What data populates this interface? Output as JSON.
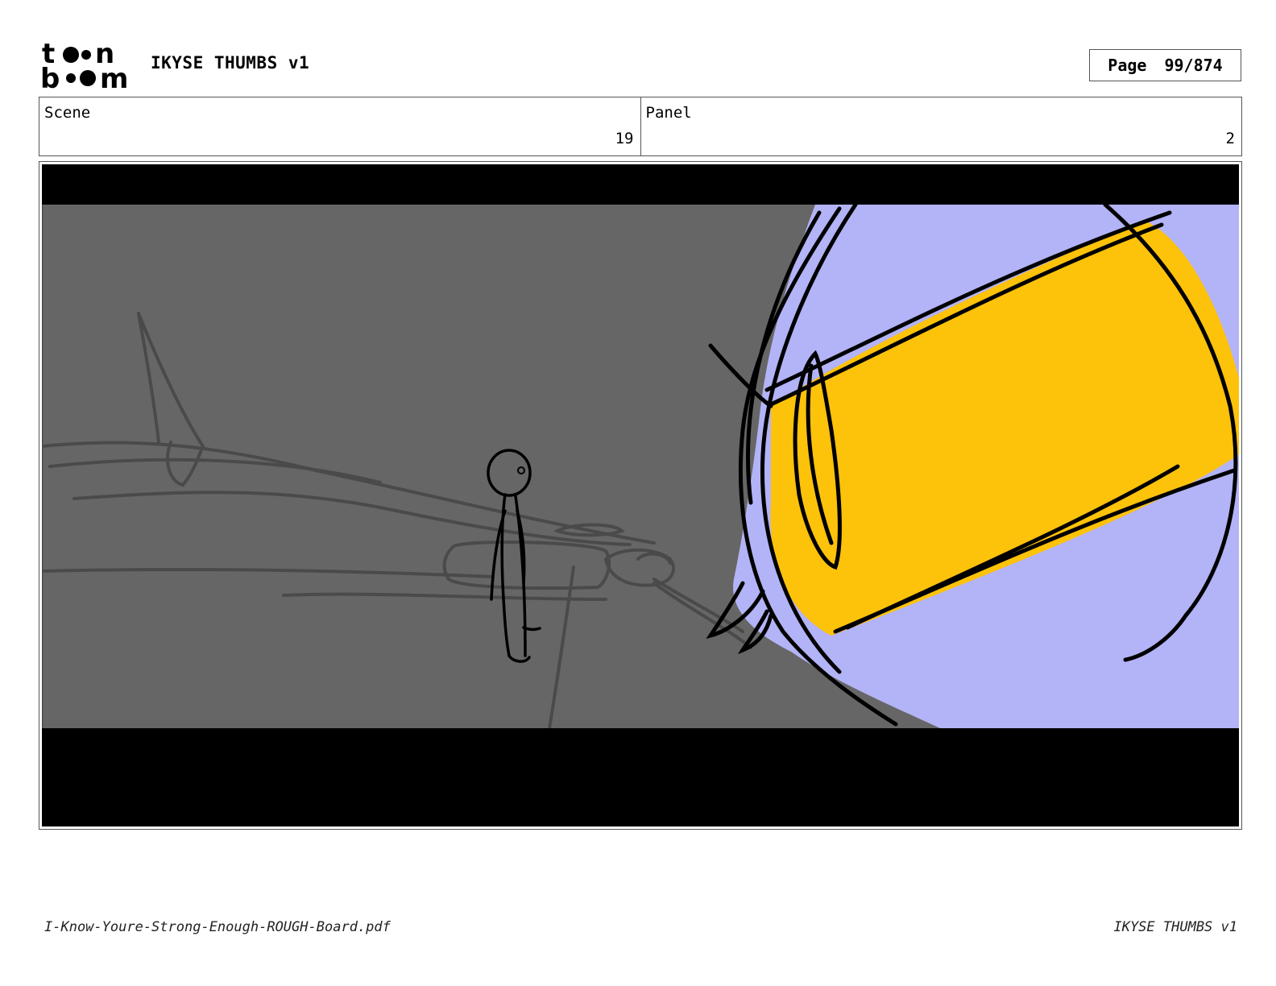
{
  "header": {
    "logo_text": "toon boom",
    "title": "IKYSE THUMBS v1",
    "page_label": "Page",
    "page_number": "99/874"
  },
  "info": {
    "scene_label": "Scene",
    "scene_value": "19",
    "panel_label": "Panel",
    "panel_value": "2"
  },
  "footer": {
    "filename": "I-Know-Youre-Strong-Enough-ROUGH-Board.pdf",
    "project": "IKYSE THUMBS v1"
  },
  "colors": {
    "background_gray": "#666666",
    "planet_lavender": "#b3b3f7",
    "tube_yellow": "#fdc20a",
    "letterbox": "#000000"
  }
}
